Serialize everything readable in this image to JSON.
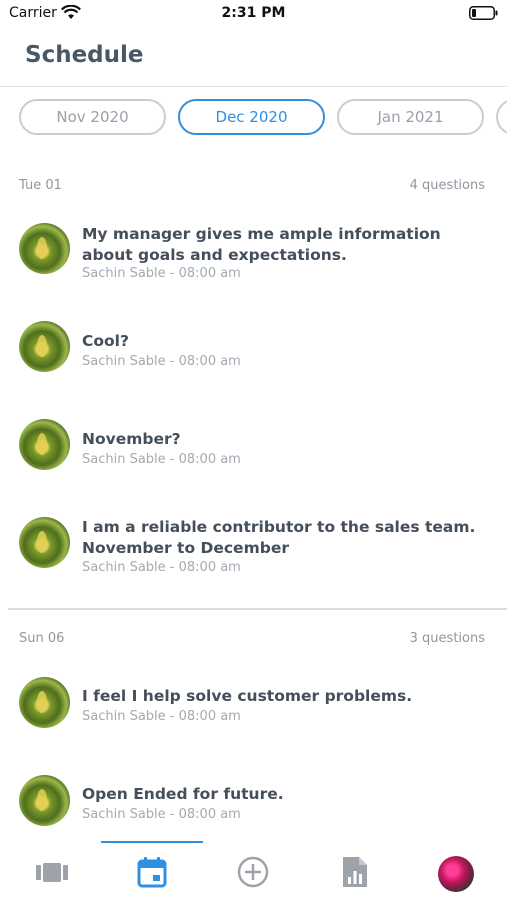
{
  "status_bar": {
    "carrier": "Carrier",
    "time": "2:31 PM"
  },
  "header": {
    "title": "Schedule"
  },
  "month_tabs": [
    {
      "label": "Nov 2020",
      "active": false
    },
    {
      "label": "Dec 2020",
      "active": true
    },
    {
      "label": "Jan 2021",
      "active": false
    }
  ],
  "sections": [
    {
      "date": "Tue 01",
      "count": "4 questions",
      "items": [
        {
          "text": "My manager gives me ample information about goals and expectations.",
          "meta": "Sachin Sable - 08:00 am"
        },
        {
          "text": "Cool?",
          "meta": "Sachin Sable - 08:00 am"
        },
        {
          "text": "November?",
          "meta": "Sachin Sable - 08:00 am"
        },
        {
          "text": "I am a reliable contributor to the sales team. November to December",
          "meta": "Sachin Sable - 08:00 am"
        }
      ]
    },
    {
      "date": "Sun 06",
      "count": "3 questions",
      "items": [
        {
          "text": "I feel I help solve customer problems.",
          "meta": "Sachin Sable - 08:00 am"
        },
        {
          "text": "Open Ended for future.",
          "meta": "Sachin Sable - 08:00 am"
        }
      ]
    }
  ],
  "tab_bar": {
    "items": [
      {
        "icon": "cards-icon",
        "active": false
      },
      {
        "icon": "calendar-icon",
        "active": true
      },
      {
        "icon": "add-circle-icon",
        "active": false
      },
      {
        "icon": "report-icon",
        "active": false
      },
      {
        "icon": "profile-avatar",
        "active": false
      }
    ]
  },
  "colors": {
    "accent": "#2f8fe0",
    "text": "#454f5b",
    "muted": "#a3aab1"
  }
}
